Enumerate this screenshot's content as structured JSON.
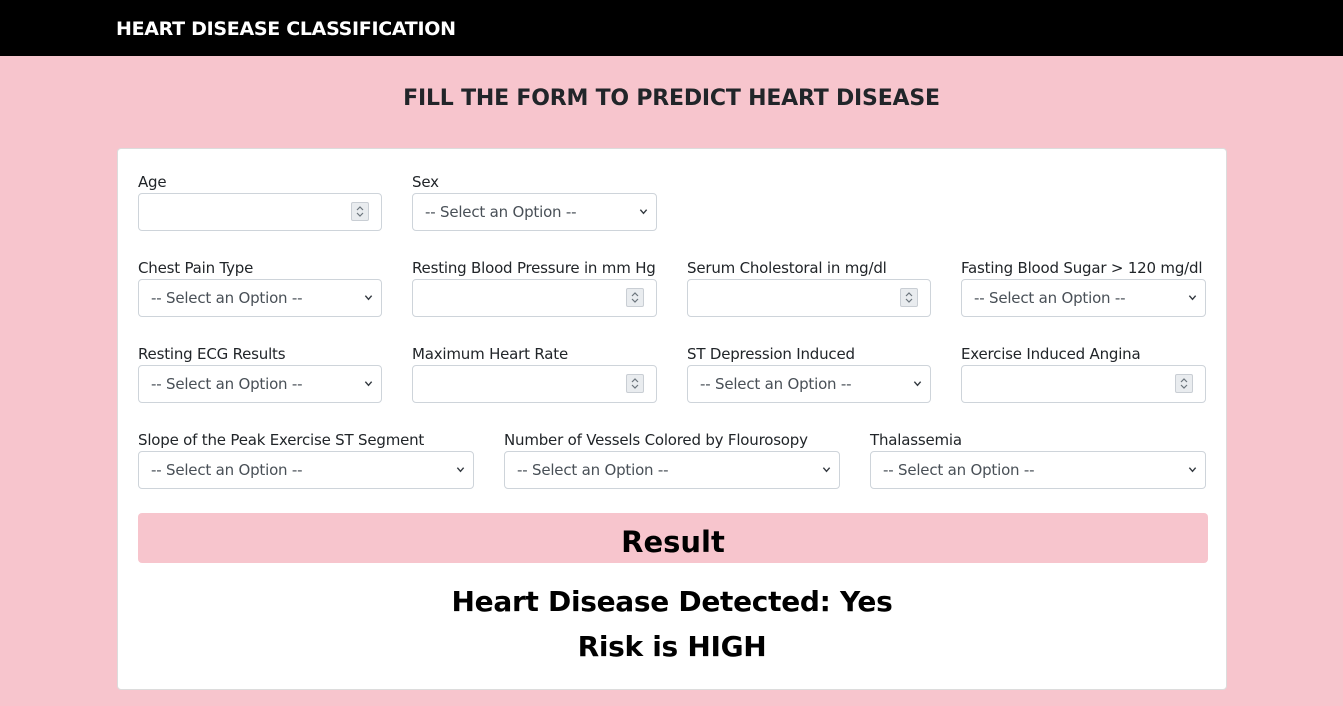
{
  "navbar": {
    "brand": "HEART DISEASE CLASSIFICATION"
  },
  "page": {
    "heading": "FILL THE FORM TO PREDICT HEART DISEASE"
  },
  "form": {
    "age": {
      "label": "Age",
      "value": ""
    },
    "sex": {
      "label": "Sex",
      "selected": "-- Select an Option --"
    },
    "chest_pain_type": {
      "label": "Chest Pain Type",
      "selected": "-- Select an Option --"
    },
    "resting_bp": {
      "label": "Resting Blood Pressure in mm Hg",
      "value": ""
    },
    "serum_cholesterol": {
      "label": "Serum Cholestoral in mg/dl",
      "value": ""
    },
    "fasting_blood_sugar": {
      "label": "Fasting Blood Sugar > 120 mg/dl",
      "selected": "-- Select an Option --"
    },
    "resting_ecg": {
      "label": "Resting ECG Results",
      "selected": "-- Select an Option --"
    },
    "max_heart_rate": {
      "label": "Maximum Heart Rate",
      "value": ""
    },
    "st_depression": {
      "label": "ST Depression Induced",
      "selected": "-- Select an Option --"
    },
    "exercise_angina": {
      "label": "Exercise Induced Angina",
      "value": ""
    },
    "slope": {
      "label": "Slope of the Peak Exercise ST Segment",
      "selected": "-- Select an Option --"
    },
    "vessels": {
      "label": "Number of Vessels Colored by Flourosopy",
      "selected": "-- Select an Option --"
    },
    "thalassemia": {
      "label": "Thalassemia",
      "selected": "-- Select an Option --"
    }
  },
  "result": {
    "button_label": "Result",
    "detected_text": "Heart Disease Detected: Yes",
    "risk_text": "Risk is HIGH"
  },
  "colors": {
    "page_background": "#f7c5cd",
    "navbar_background": "#000000",
    "card_background": "#ffffff",
    "result_bar": "#f7c5cd"
  },
  "icons": {
    "select_arrow": "chevron-down-icon",
    "number_spinner": "spinner-icon"
  }
}
